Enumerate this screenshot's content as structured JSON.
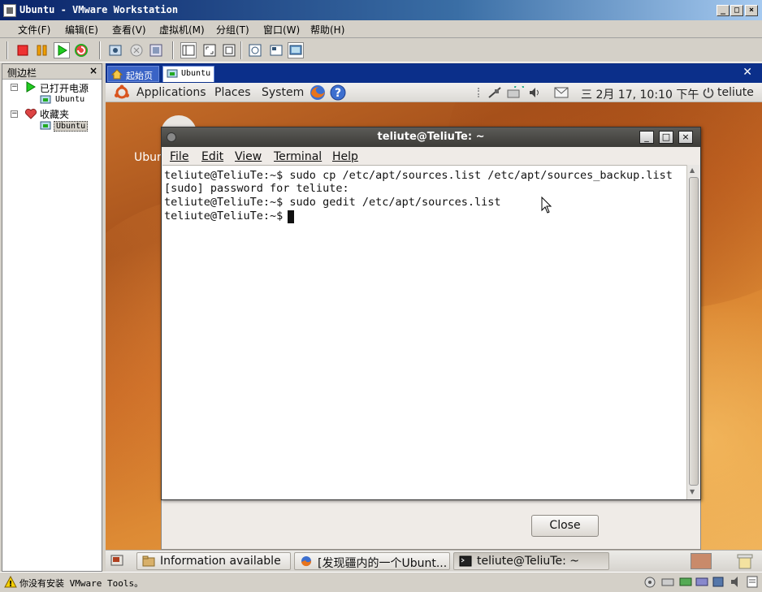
{
  "window": {
    "title": "Ubuntu - VMware Workstation",
    "minimize": "_",
    "maximize": "□",
    "close": "×"
  },
  "menu": [
    "文件(F)",
    "编辑(E)",
    "查看(V)",
    "虚拟机(M)",
    "分组(T)",
    "窗口(W)",
    "帮助(H)"
  ],
  "sidebar": {
    "title": "侧边栏",
    "close": "×",
    "powered_on": "已打开电源",
    "powered_on_vm": "Ubuntu",
    "favorites": "收藏夹",
    "favorites_vm": "Ubuntu",
    "expander": "−"
  },
  "tabs": {
    "home": "起始页",
    "ubuntu": "Ubuntu",
    "close": "✕"
  },
  "gnome_panel": {
    "applications": "Applications",
    "places": "Places",
    "system": "System",
    "clock": "三 2月 17, 10:10 下午",
    "user": "teliute"
  },
  "desktop": {
    "partial_icon_label": "Ubun"
  },
  "terminal": {
    "title": "teliute@TeliuTe: ~",
    "menu": {
      "file": "File",
      "edit": "Edit",
      "view": "View",
      "terminal": "Terminal",
      "help": "Help"
    },
    "lines": [
      "teliute@TeliuTe:~$ sudo cp /etc/apt/sources.list /etc/apt/sources_backup.list",
      "[sudo] password for teliute:",
      "teliute@TeliuTe:~$ sudo gedit /etc/apt/sources.list",
      "teliute@TeliuTe:~$ "
    ],
    "btn_min": "_",
    "btn_max": "□",
    "btn_close": "×"
  },
  "dialog": {
    "close_label": "Close"
  },
  "taskbar": {
    "items": [
      "Information available",
      "[发现疆内的一个Ubunt...",
      "teliute@TeliuTe: ~"
    ]
  },
  "status": {
    "text": "你没有安装 VMware Tools。"
  },
  "colors": {
    "titlebar_start": "#0a246a",
    "ubuntu_orange": "#c96a25",
    "terminal_title": "#3c3b37"
  }
}
